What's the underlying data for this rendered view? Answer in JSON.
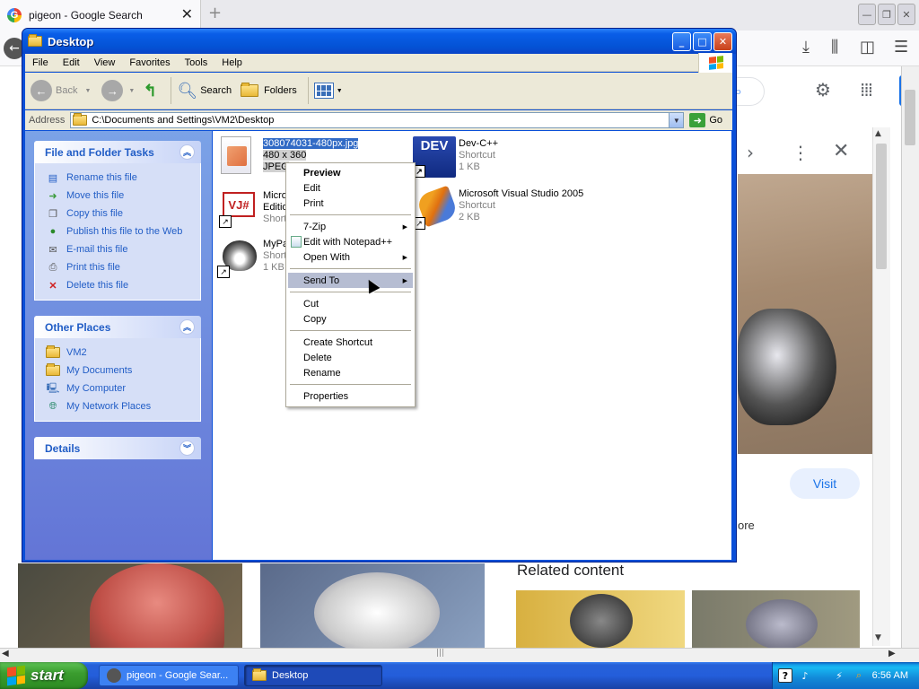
{
  "firefox": {
    "tab_title": "pigeon - Google Search",
    "tab_close": "✕",
    "new_tab": "+"
  },
  "google": {
    "visit_label": "Visit",
    "more_text": "ore",
    "related_heading": "Related content"
  },
  "explorer": {
    "title": "Desktop",
    "menu": [
      "File",
      "Edit",
      "View",
      "Favorites",
      "Tools",
      "Help"
    ],
    "toolbar": {
      "back_label": "Back",
      "search_label": "Search",
      "folders_label": "Folders"
    },
    "address": {
      "label": "Address",
      "value": "C:\\Documents and Settings\\VM2\\Desktop",
      "go_label": "Go"
    },
    "file_tasks": {
      "title": "File and Folder Tasks",
      "items": [
        {
          "label": "Rename this file",
          "icon": "rename-icon"
        },
        {
          "label": "Move this file",
          "icon": "move-icon"
        },
        {
          "label": "Copy this file",
          "icon": "copy-icon"
        },
        {
          "label": "Publish this file to the Web",
          "icon": "globe-icon"
        },
        {
          "label": "E-mail this file",
          "icon": "email-icon"
        },
        {
          "label": "Print this file",
          "icon": "printer-icon"
        },
        {
          "label": "Delete this file",
          "icon": "delete-icon"
        }
      ]
    },
    "other_places": {
      "title": "Other Places",
      "items": [
        {
          "label": "VM2",
          "icon": "folder-icon"
        },
        {
          "label": "My Documents",
          "icon": "my-documents-icon"
        },
        {
          "label": "My Computer",
          "icon": "my-computer-icon"
        },
        {
          "label": "My Network Places",
          "icon": "network-places-icon"
        }
      ]
    },
    "details": {
      "title": "Details"
    },
    "files": [
      {
        "name": "308074031-480px.jpg",
        "line2": "480 x 360",
        "line3": "JPEG",
        "icon": "jpeg-image-icon"
      },
      {
        "name": "Dev-C++",
        "line2": "Shortcut",
        "line3": "1 KB",
        "icon": "dev-cpp-icon"
      },
      {
        "name": "Micro",
        "line2": "Editio",
        "line3": "Shortc",
        "icon": "visual-jsharp-icon"
      },
      {
        "name": "Microsoft Visual Studio 2005",
        "line2": "Shortcut",
        "line3": "2 KB",
        "icon": "visual-studio-icon"
      },
      {
        "name": "MyPa",
        "line2": "Short",
        "line3": "1 KB",
        "icon": "raccoon-icon"
      }
    ]
  },
  "context_menu": {
    "preview": "Preview",
    "edit": "Edit",
    "print": "Print",
    "zip": "7-Zip",
    "notepad": "Edit with Notepad++",
    "open_with": "Open With",
    "send_to": "Send To",
    "cut": "Cut",
    "copy": "Copy",
    "create_shortcut": "Create Shortcut",
    "delete": "Delete",
    "rename": "Rename",
    "properties": "Properties"
  },
  "taskbar": {
    "start_label": "start",
    "items": [
      "pigeon - Google Sear...",
      "Desktop"
    ],
    "clock": "6:56 AM"
  },
  "colors": {
    "xp_blue": "#0453d6",
    "task_pane_link": "#215dc6",
    "selection": "#316ac5",
    "start_green": "#3b9d2f"
  }
}
